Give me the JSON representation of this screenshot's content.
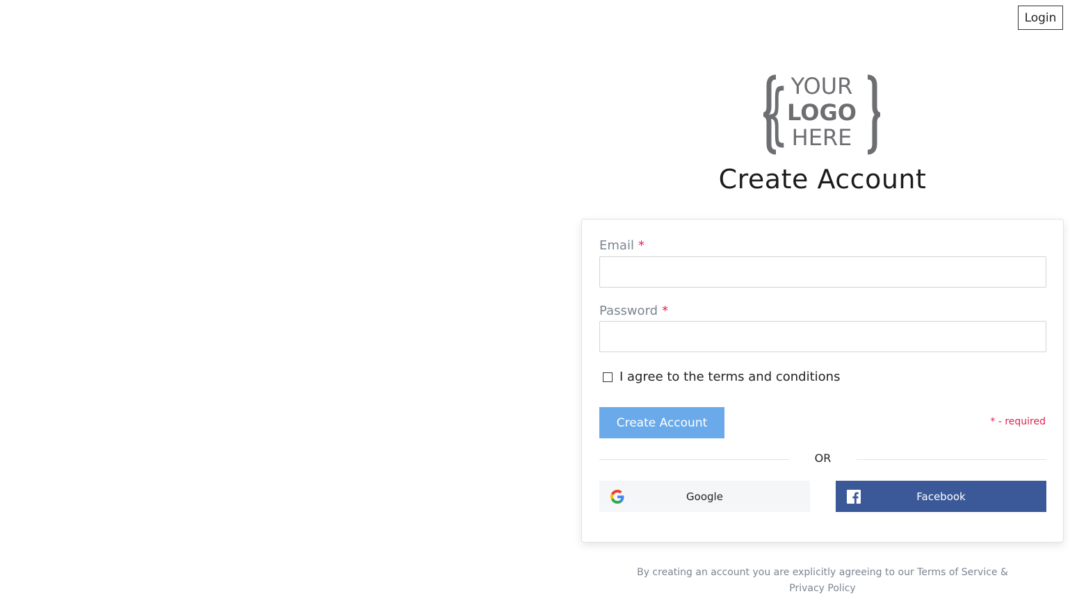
{
  "header": {
    "login_label": "Login"
  },
  "logo": {
    "line1": "YOUR",
    "line2": "LOGO",
    "line3": "HERE"
  },
  "page": {
    "title": "Create Account"
  },
  "form": {
    "email_label": "Email",
    "email_value": "",
    "password_label": "Password",
    "password_value": "",
    "required_marker": "*",
    "terms_label": "I agree to the terms and conditions",
    "terms_checked": false,
    "submit_label": "Create Account",
    "required_note": "* - required",
    "divider_text": "OR"
  },
  "social": {
    "google_label": "Google",
    "facebook_label": "Facebook",
    "google_icon": "google-g-icon",
    "facebook_icon": "facebook-f-icon"
  },
  "footer": {
    "line1": "By creating an account you are explicitly agreeing to our Terms of Service &",
    "line2": "Privacy Policy"
  },
  "colors": {
    "primary_button": "#6aaaea",
    "facebook": "#3b5998",
    "required": "#e0224e",
    "label_gray": "#7b8591",
    "logo_gray": "#6d6e71"
  }
}
